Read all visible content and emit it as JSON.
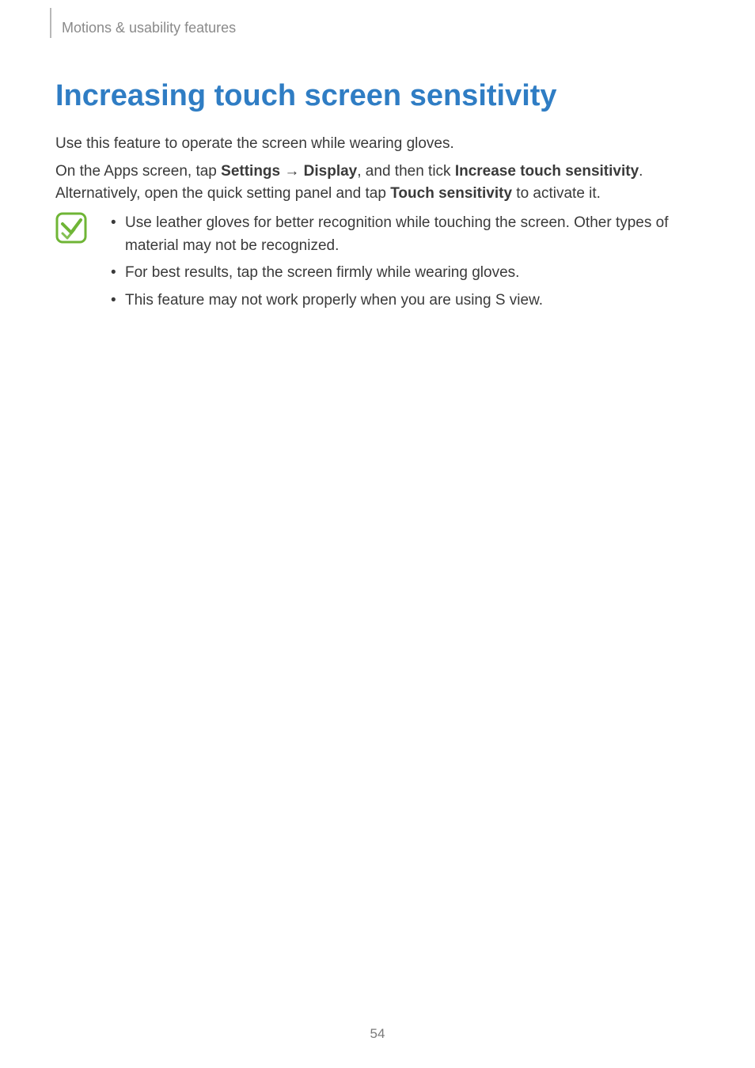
{
  "header": {
    "section": "Motions & usability features"
  },
  "title": "Increasing touch screen sensitivity",
  "intro": "Use this feature to operate the screen while wearing gloves.",
  "instruction": {
    "pre": "On the Apps screen, tap ",
    "b1": "Settings",
    "arrow": " → ",
    "b2": "Display",
    "mid1": ", and then tick ",
    "b3": "Increase touch sensitivity",
    "mid2": ". Alternatively, open the quick setting panel and tap ",
    "b4": "Touch sensitivity",
    "post": " to activate it."
  },
  "notes": [
    "Use leather gloves for better recognition while touching the screen. Other types of material may not be recognized.",
    "For best results, tap the screen firmly while wearing gloves.",
    "This feature may not work properly when you are using S view."
  ],
  "page_number": "54"
}
